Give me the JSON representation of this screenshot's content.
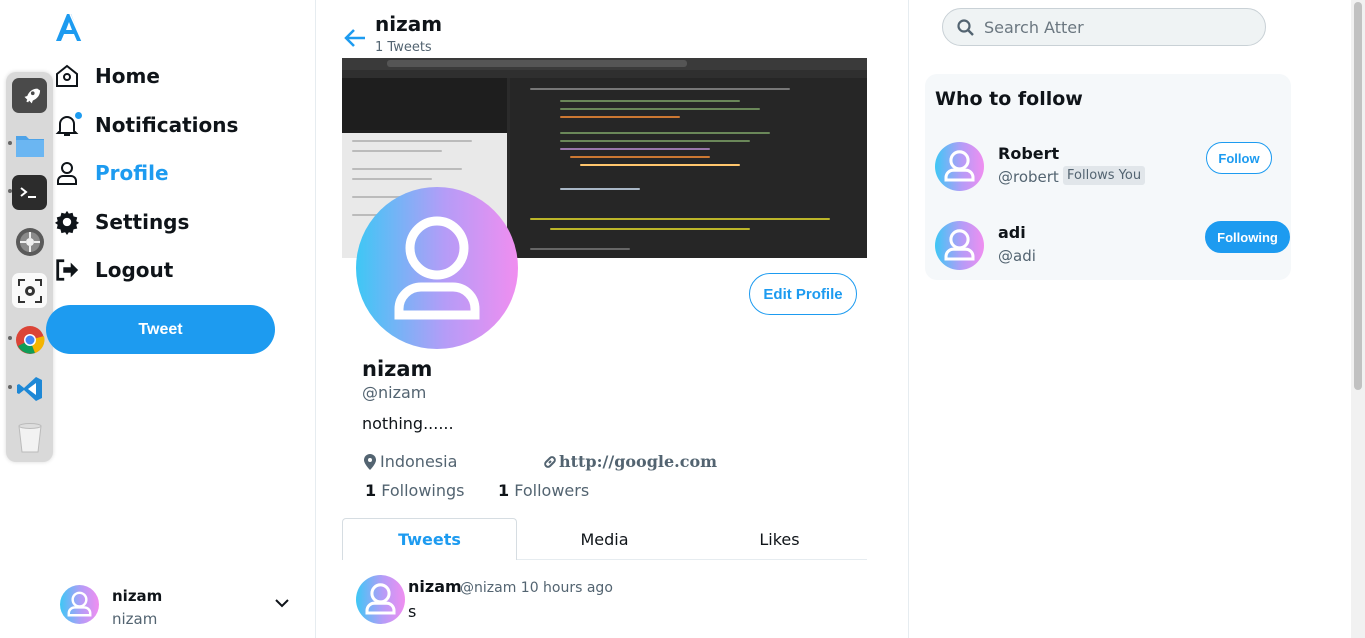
{
  "app": {
    "name": "Atter"
  },
  "nav": {
    "items": [
      {
        "key": "home",
        "label": "Home",
        "icon": "home-icon"
      },
      {
        "key": "notifications",
        "label": "Notifications",
        "icon": "bell-icon"
      },
      {
        "key": "profile",
        "label": "Profile",
        "icon": "user-icon"
      },
      {
        "key": "settings",
        "label": "Settings",
        "icon": "gear-icon"
      },
      {
        "key": "logout",
        "label": "Logout",
        "icon": "logout-icon"
      }
    ],
    "active": "profile",
    "tweet_button": "Tweet"
  },
  "account": {
    "name": "nizam",
    "handle": "nizam"
  },
  "header": {
    "name": "nizam",
    "tweet_count": "1 Tweets"
  },
  "profile": {
    "name": "nizam",
    "handle": "@nizam",
    "bio": "nothing......",
    "location": "Indonesia",
    "website": "http://google.com",
    "followings_count": "1",
    "followings_label": "Followings",
    "followers_count": "1",
    "followers_label": "Followers",
    "edit_button": "Edit Profile"
  },
  "tabs": [
    {
      "label": "Tweets",
      "active": true
    },
    {
      "label": "Media",
      "active": false
    },
    {
      "label": "Likes",
      "active": false
    }
  ],
  "tweets": [
    {
      "name": "nizam",
      "handle": "@nizam",
      "time": "10 hours ago",
      "body": "s"
    }
  ],
  "search": {
    "placeholder": "Search Atter"
  },
  "who_to_follow": {
    "title": "Who to follow",
    "users": [
      {
        "name": "Robert",
        "handle": "@robert",
        "badge": "Follows You",
        "button": "Follow"
      },
      {
        "name": "adi",
        "handle": "@adi",
        "badge": "",
        "button": "Following"
      }
    ]
  },
  "dock": {
    "apps": [
      "launcher-icon",
      "files-icon",
      "terminal-icon",
      "system-settings-icon",
      "screenshot-icon",
      "chrome-icon",
      "vscode-icon",
      "trash-icon"
    ]
  },
  "colors": {
    "accent": "#1d9bf0",
    "text": "#0f1419",
    "muted": "#536471"
  }
}
